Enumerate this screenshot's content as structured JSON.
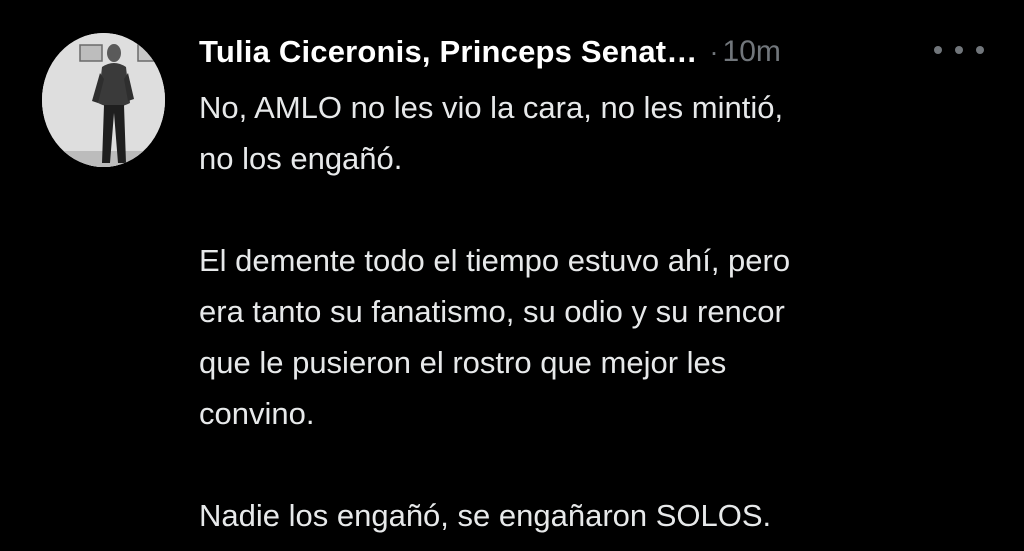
{
  "tweet": {
    "author_name": "Tulia Ciceronis, Princeps Senat…",
    "separator": "·",
    "timestamp": "10m",
    "more_icon": "more-horizontal-icon",
    "avatar_icon": "profile-photo",
    "paragraphs": [
      {
        "lines": [
          "No, AMLO no les vio la cara, no les mintió,",
          "no los engañó."
        ]
      },
      {
        "lines": [
          "El demente todo el tiempo estuvo ahí, pero",
          "era tanto su fanatismo, su odio y su rencor",
          "que le pusieron el rostro que mejor les",
          "convino."
        ]
      },
      {
        "lines": [
          "Nadie los engañó, se engañaron SOLOS."
        ]
      }
    ]
  },
  "colors": {
    "background": "#000000",
    "text": "#e7e9ea",
    "name": "#ffffff",
    "muted": "#71767b"
  }
}
